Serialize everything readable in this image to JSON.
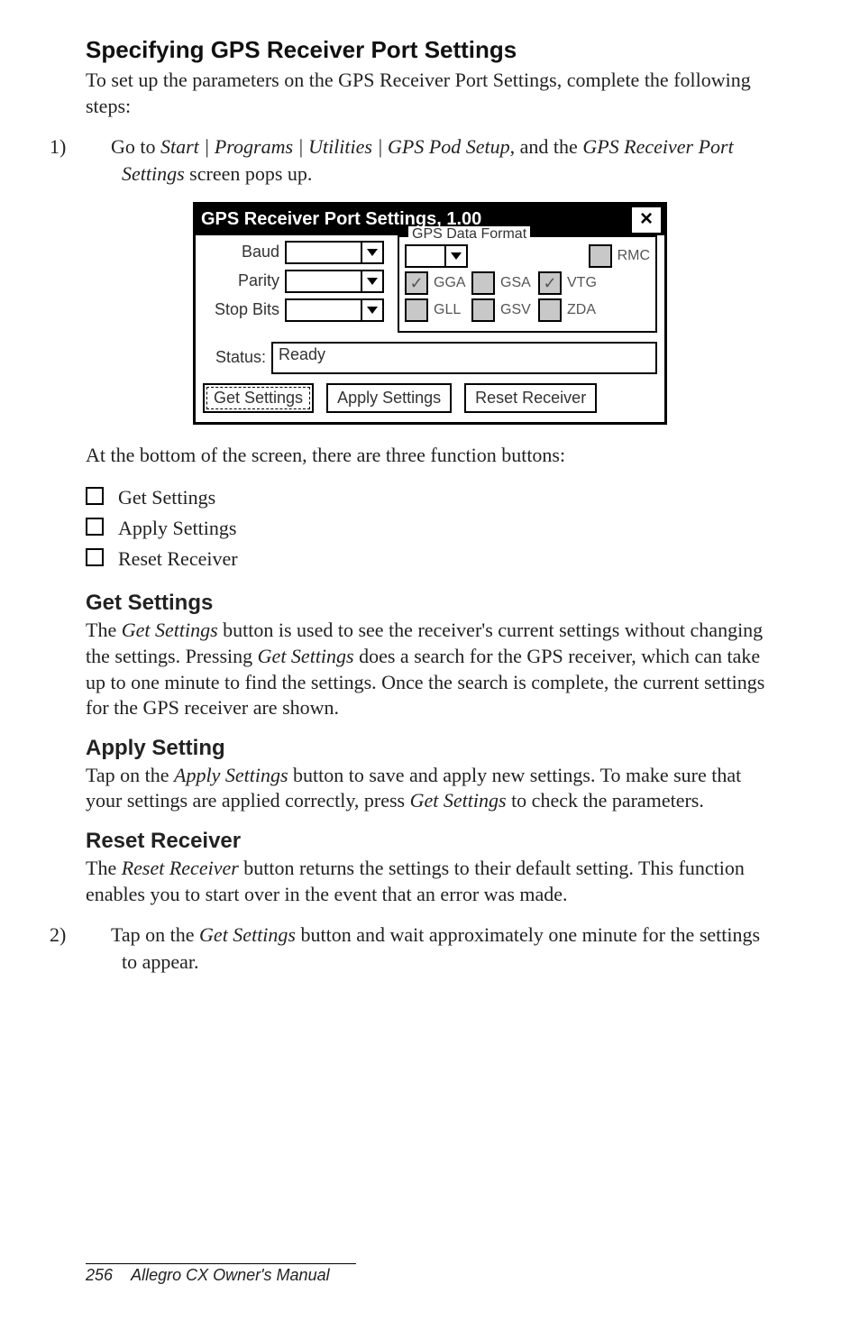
{
  "heading": "Specifying GPS Receiver Port Settings",
  "intro": "To set up the parameters on the GPS Receiver Port Settings, complete the following steps:",
  "step1_num": "1)",
  "step1_a": "Go to ",
  "step1_italic": "Start | Programs | Utilities | GPS Pod Setup",
  "step1_b": ", and the ",
  "step1_italic2": "GPS Receiver Port Settings",
  "step1_c": " screen pops up.",
  "dialog": {
    "title": "GPS Receiver Port Settings, 1.00",
    "close": "×",
    "labels": {
      "baud": "Baud",
      "parity": "Parity",
      "stopbits": "Stop Bits"
    },
    "fieldset_legend": "GPS Data Format",
    "checks": {
      "rmc": "RMC",
      "gga": "GGA",
      "gsa": "GSA",
      "vtg": "VTG",
      "gll": "GLL",
      "gsv": "GSV",
      "zda": "ZDA"
    },
    "status_label": "Status:",
    "status_value": "Ready",
    "buttons": {
      "get": "Get Settings",
      "apply": "Apply Settings",
      "reset": "Reset Receiver"
    }
  },
  "after_dialog": "At the bottom of the screen, there are three function buttons:",
  "bullets": [
    "Get Settings",
    "Apply Settings",
    "Reset Receiver"
  ],
  "get_heading": "Get Settings",
  "get_a": "The ",
  "get_i1": "Get Settings",
  "get_b": " button is used to see the receiver's current settings without changing the settings. Pressing ",
  "get_i2": "Get Settings",
  "get_c": " does a search for the GPS receiver, which can take up to one minute to find the settings. Once the search is complete, the current settings for the GPS receiver are shown.",
  "apply_heading": "Apply Setting",
  "apply_a": "Tap on the ",
  "apply_i1": "Apply Settings",
  "apply_b": " button to save and apply new settings. To make sure that your settings are applied correctly, press ",
  "apply_i2": "Get Settings",
  "apply_c": " to check the parameters.",
  "reset_heading": "Reset Receiver",
  "reset_a": "The ",
  "reset_i1": "Reset Receiver",
  "reset_b": " button returns the settings to their default setting. This function enables you to start over in the event that an error was made.",
  "step2_num": "2)",
  "step2_a": "Tap on the ",
  "step2_i1": "Get Settings",
  "step2_b": " button and wait approximately one minute for the settings to appear.",
  "footer_page": "256",
  "footer_title": "Allegro CX Owner's Manual"
}
